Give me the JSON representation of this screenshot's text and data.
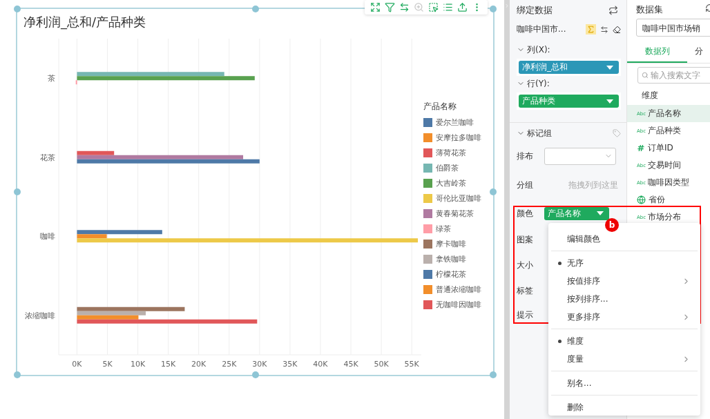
{
  "chart_widget": {
    "title": "净利润_总和/产品种类",
    "legend_title": "产品名称",
    "toolbar": [
      {
        "kind": "expand",
        "disabled": false
      },
      {
        "kind": "filter",
        "disabled": false
      },
      {
        "kind": "swap",
        "disabled": false
      },
      {
        "kind": "zoom",
        "disabled": true
      },
      {
        "kind": "select",
        "disabled": false
      },
      {
        "kind": "list",
        "disabled": false
      },
      {
        "kind": "export",
        "disabled": false
      },
      {
        "kind": "more",
        "disabled": false
      }
    ],
    "chart_data": {
      "type": "bar",
      "orientation": "horizontal",
      "grid": true,
      "legend": "right",
      "categories": [
        "茶",
        "花茶",
        "咖啡",
        "浓缩咖啡"
      ],
      "xlim": [
        -3000,
        56000
      ],
      "xticks": [
        {
          "value": 0,
          "label": "0K"
        },
        {
          "value": 5000,
          "label": "5K"
        },
        {
          "value": 10000,
          "label": "10K"
        },
        {
          "value": 15000,
          "label": "15K"
        },
        {
          "value": 20000,
          "label": "20K"
        },
        {
          "value": 25000,
          "label": "25K"
        },
        {
          "value": 30000,
          "label": "30K"
        },
        {
          "value": 35000,
          "label": "35K"
        },
        {
          "value": 40000,
          "label": "40K"
        },
        {
          "value": 45000,
          "label": "45K"
        },
        {
          "value": 50000,
          "label": "50K"
        },
        {
          "value": 55000,
          "label": "55K"
        }
      ],
      "series": [
        {
          "name": "爱尔兰咖啡",
          "color": "#4e79a7",
          "values": [
            null,
            null,
            14000,
            null
          ]
        },
        {
          "name": "安摩拉多咖啡",
          "color": "#f28e2b",
          "values": [
            null,
            null,
            4900,
            null
          ]
        },
        {
          "name": "薄荷花茶",
          "color": "#e15759",
          "values": [
            null,
            6100,
            null,
            null
          ]
        },
        {
          "name": "伯爵茶",
          "color": "#76b7b2",
          "values": [
            24200,
            null,
            null,
            null
          ]
        },
        {
          "name": "大吉岭茶",
          "color": "#59a14f",
          "values": [
            29200,
            null,
            null,
            null
          ]
        },
        {
          "name": "哥伦比亚咖啡",
          "color": "#edc948",
          "values": [
            null,
            null,
            56000,
            null
          ]
        },
        {
          "name": "黄春菊花茶",
          "color": "#b07aa1",
          "values": [
            null,
            27300,
            null,
            null
          ]
        },
        {
          "name": "绿茶",
          "color": "#ff9da7",
          "values": [
            -200,
            null,
            null,
            null
          ]
        },
        {
          "name": "摩卡咖啡",
          "color": "#9c755f",
          "values": [
            null,
            null,
            null,
            17700
          ]
        },
        {
          "name": "拿铁咖啡",
          "color": "#bab0ac",
          "values": [
            null,
            null,
            null,
            11300
          ]
        },
        {
          "name": "柠檬花茶",
          "color": "#4e79a7",
          "values": [
            null,
            30000,
            null,
            null
          ]
        },
        {
          "name": "普通浓缩咖啡",
          "color": "#f28e2b",
          "values": [
            null,
            null,
            null,
            10100
          ]
        },
        {
          "name": "无咖啡因咖啡",
          "color": "#e15759",
          "values": [
            null,
            null,
            null,
            29600
          ]
        }
      ]
    }
  },
  "binding_panel": {
    "title": "绑定数据",
    "dataset": "咖啡中国市...",
    "sigma_active": true,
    "shelves": [
      {
        "label": "列(X):",
        "expanded": true,
        "pill": {
          "text": "净利润_总和",
          "kind": "measure"
        }
      },
      {
        "label": "行(Y):",
        "expanded": true,
        "pill": {
          "text": "产品种类",
          "kind": "dimension"
        }
      }
    ],
    "marks": {
      "label": "标记组",
      "expanded": true,
      "rows": [
        {
          "label": "排布",
          "kind": "select"
        },
        {
          "label": "分组",
          "kind": "drop",
          "hint": "拖拽列到这里"
        },
        {
          "label": "颜色",
          "kind": "pill",
          "pill": {
            "text": "产品名称",
            "kind": "dimension"
          }
        },
        {
          "label": "图案",
          "kind": "empty"
        },
        {
          "label": "大小",
          "kind": "empty"
        },
        {
          "label": "标签",
          "kind": "empty"
        },
        {
          "label": "提示",
          "kind": "empty"
        }
      ]
    }
  },
  "dataset_panel": {
    "title": "数据集",
    "dataset": "咖啡中国市场销",
    "tabs": [
      {
        "label": "数据列",
        "selected": true
      },
      {
        "label": "分",
        "selected": false
      }
    ],
    "search": {
      "placeholder": "输入搜索文字"
    },
    "group_label": "维度",
    "fields": [
      {
        "name": "产品名称",
        "kind": "text",
        "badge": "Abc",
        "selected": true
      },
      {
        "name": "产品种类",
        "kind": "text",
        "badge": "Abc",
        "selected": false
      },
      {
        "name": "订单ID",
        "kind": "number",
        "badge": "#",
        "selected": false
      },
      {
        "name": "交易时间",
        "kind": "text",
        "badge": "Abc",
        "selected": false
      },
      {
        "name": "咖啡因类型",
        "kind": "text",
        "badge": "Abc",
        "selected": false
      },
      {
        "name": "省份",
        "kind": "geo",
        "selected": false
      },
      {
        "name": "市场分布",
        "kind": "text",
        "badge": "Abc",
        "selected": false
      }
    ]
  },
  "context_menu": {
    "sections": [
      [
        {
          "label": "编辑颜色",
          "checked": false,
          "submenu": false
        }
      ],
      [
        {
          "label": "无序",
          "checked": true,
          "submenu": false
        },
        {
          "label": "按值排序",
          "checked": false,
          "submenu": true
        },
        {
          "label": "按列排序...",
          "checked": false,
          "submenu": false
        },
        {
          "label": "更多排序",
          "checked": false,
          "submenu": true
        }
      ],
      [
        {
          "label": "维度",
          "checked": true,
          "submenu": false
        },
        {
          "label": "度量",
          "checked": false,
          "submenu": true
        }
      ],
      [
        {
          "label": "别名...",
          "checked": false,
          "submenu": false
        }
      ],
      [
        {
          "label": "删除",
          "checked": false,
          "submenu": false
        }
      ]
    ]
  },
  "annotation": {
    "badge": "b"
  }
}
